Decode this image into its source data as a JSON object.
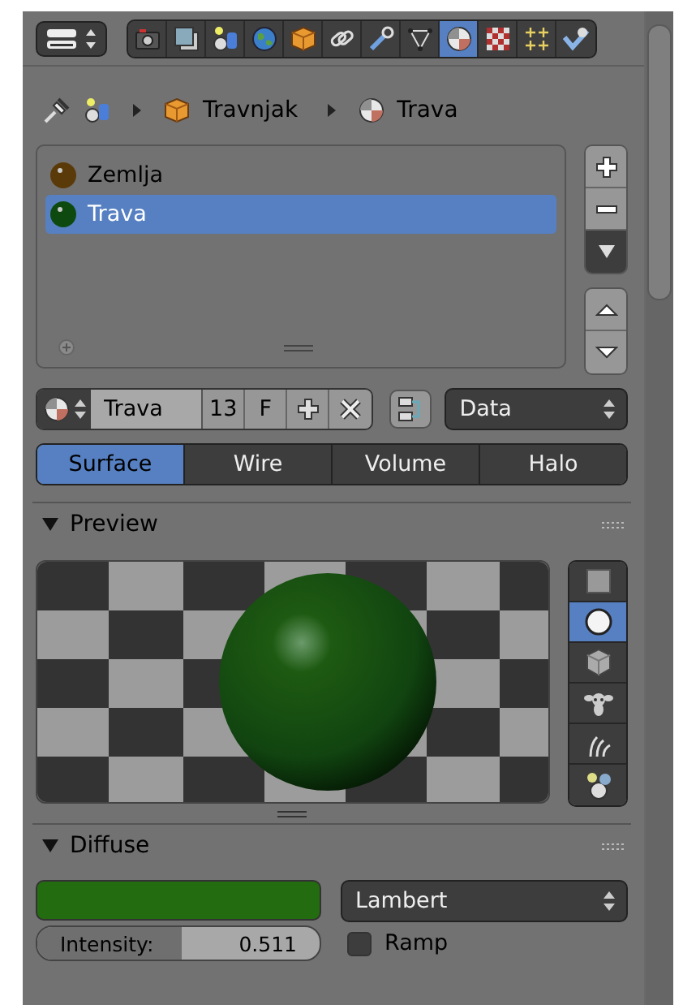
{
  "header": {
    "context_tabs": [
      {
        "kind": "render",
        "selected": false
      },
      {
        "kind": "render_layers",
        "selected": false
      },
      {
        "kind": "scene",
        "selected": false
      },
      {
        "kind": "world",
        "selected": false
      },
      {
        "kind": "object",
        "selected": false
      },
      {
        "kind": "constraints",
        "selected": false
      },
      {
        "kind": "modifiers",
        "selected": false
      },
      {
        "kind": "data",
        "selected": false
      },
      {
        "kind": "material",
        "selected": true
      },
      {
        "kind": "texture",
        "selected": false
      },
      {
        "kind": "particles",
        "selected": false
      },
      {
        "kind": "physics",
        "selected": false
      }
    ]
  },
  "breadcrumb": [
    {
      "kind": "scene"
    },
    {
      "kind": "object",
      "label": "Travnjak"
    },
    {
      "kind": "material",
      "label": "Trava"
    }
  ],
  "material_slots": [
    {
      "name": "Zemlja",
      "color": "#5b3a0a",
      "selected": false
    },
    {
      "name": "Trava",
      "color": "#0e4a10",
      "selected": true
    }
  ],
  "datablock": {
    "name": "Trava",
    "users": "13",
    "fake_user": "F",
    "link": "Data"
  },
  "material_type_tabs": [
    {
      "label": "Surface",
      "selected": true
    },
    {
      "label": "Wire",
      "selected": false
    },
    {
      "label": "Volume",
      "selected": false
    },
    {
      "label": "Halo",
      "selected": false
    }
  ],
  "preview": {
    "title": "Preview",
    "expanded": true,
    "preview_types": [
      {
        "kind": "flat",
        "selected": false
      },
      {
        "kind": "sphere",
        "selected": true
      },
      {
        "kind": "cube",
        "selected": false
      },
      {
        "kind": "monkey",
        "selected": false
      },
      {
        "kind": "hair",
        "selected": false
      },
      {
        "kind": "sky_sphere",
        "selected": false
      }
    ]
  },
  "diffuse": {
    "title": "Diffuse",
    "expanded": true,
    "color": "#236c0f",
    "shader": "Lambert",
    "intensity": {
      "label": "Intensity:",
      "value": "0.511",
      "level": 0.511
    },
    "ramp": {
      "label": "Ramp",
      "checked": false
    }
  }
}
